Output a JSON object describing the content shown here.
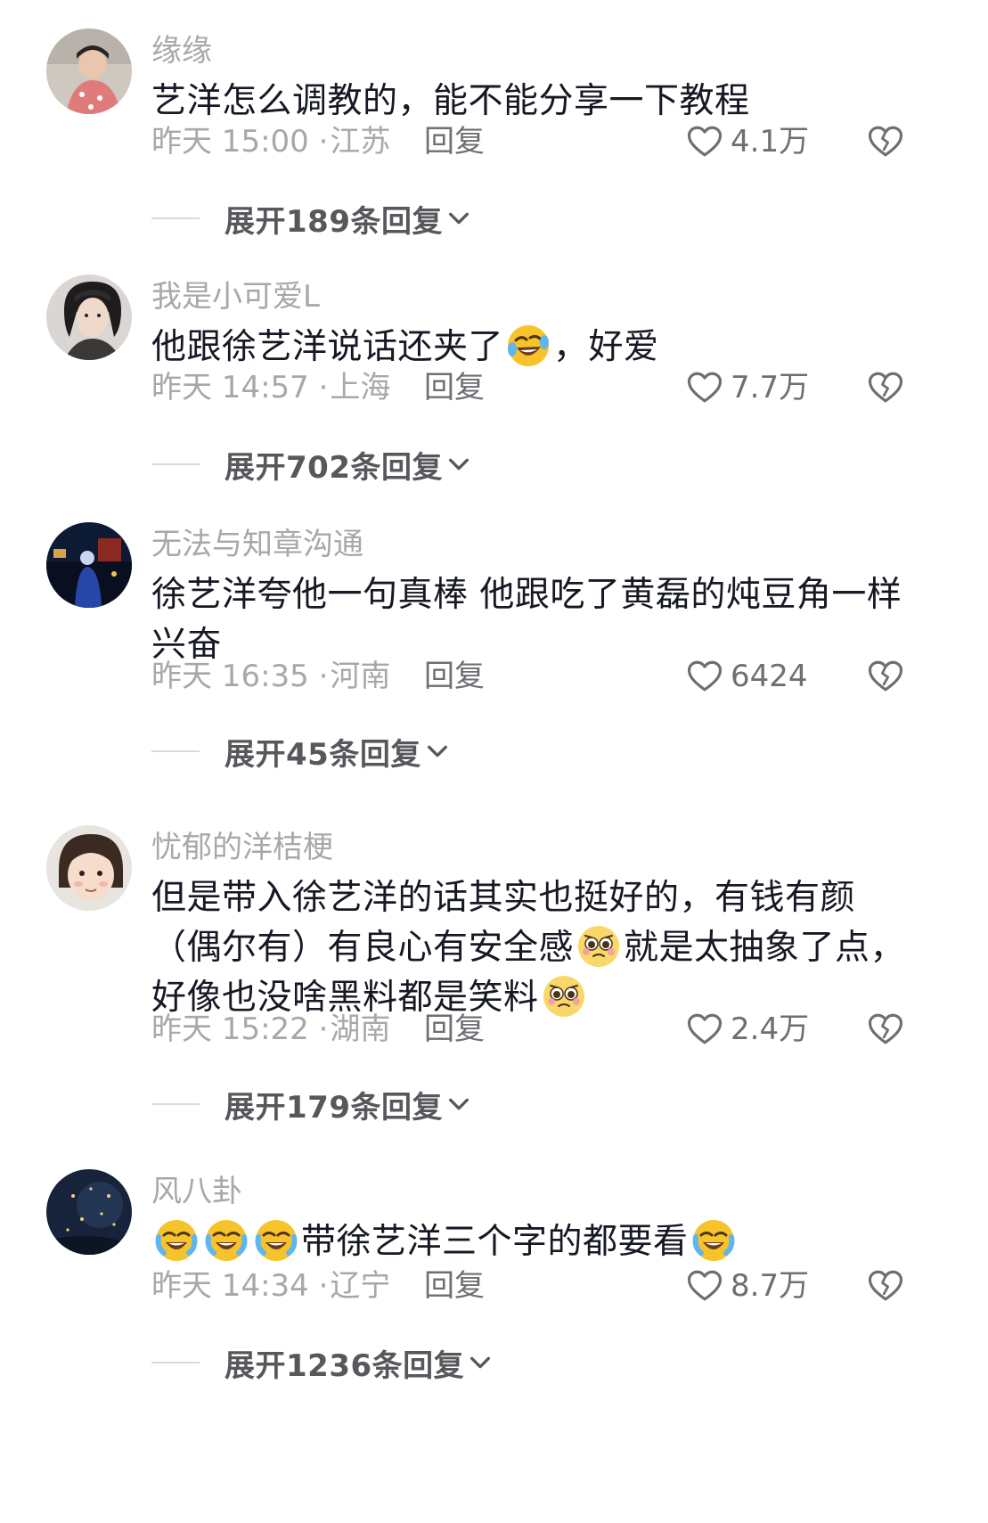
{
  "comments": [
    {
      "username": "缘缘",
      "content": [
        "艺洋怎么调教的，能不能分享一下教程"
      ],
      "time": "昨天 15:00 ·",
      "location": "江苏",
      "reply_label": "回复",
      "likes": "4.1万",
      "expand_label": "展开189条回复"
    },
    {
      "username": "我是小可爱L",
      "content": [
        "他跟徐艺洋说话还夹了",
        "，好爱"
      ],
      "emoji": "rolling-laughing-emoji",
      "time": "昨天 14:57 ·",
      "location": "上海",
      "reply_label": "回复",
      "likes": "7.7万",
      "expand_label": "展开702条回复"
    },
    {
      "username": "无法与知章沟通",
      "content": [
        "徐艺洋夸他一句真棒 他跟吃了黄磊的炖豆角一样兴奋"
      ],
      "time": "昨天 16:35 ·",
      "location": "河南",
      "reply_label": "回复",
      "likes": "6424",
      "expand_label": "展开45条回复"
    },
    {
      "username": "忧郁的洋桔梗",
      "content": [
        "但是带入徐艺洋的话其实也挺好的，有钱有颜（偶尔有）有良心有安全感",
        "就是太抽象了点，好像也没啥黑料都是笑料"
      ],
      "emoji": "pleading-face-emoji",
      "time": "昨天 15:22 ·",
      "location": "湖南",
      "reply_label": "回复",
      "likes": "2.4万",
      "expand_label": "展开179条回复"
    },
    {
      "username": "风八卦",
      "content": [
        "带徐艺洋三个字的都要看"
      ],
      "emoji": "crying-laughing-emoji",
      "time": "昨天 14:34 ·",
      "location": "辽宁",
      "reply_label": "回复",
      "likes": "8.7万",
      "expand_label": "展开1236条回复"
    }
  ],
  "icons": {
    "like": "heart-outline-icon",
    "dislike": "broken-heart-icon",
    "expand": "chevron-down-icon"
  },
  "colors": {
    "text_primary": "#161823",
    "text_secondary": "#a8a8ab",
    "action_text": "#6e6e73"
  }
}
